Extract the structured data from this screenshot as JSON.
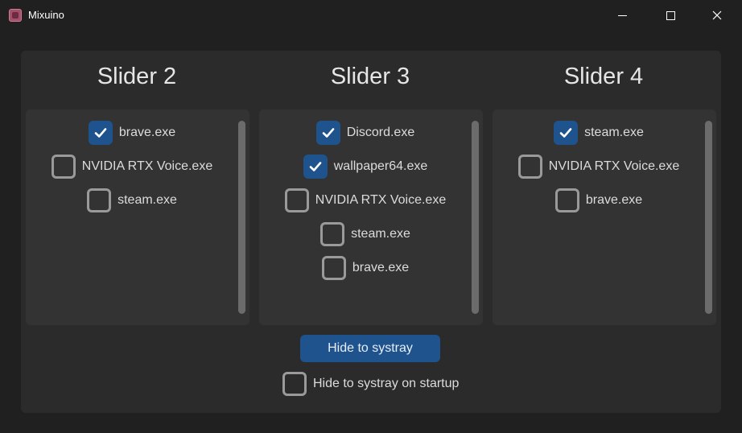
{
  "window": {
    "title": "Mixuino"
  },
  "columns": [
    {
      "title": "Slider 2",
      "items": [
        {
          "label": "brave.exe",
          "checked": true
        },
        {
          "label": "NVIDIA RTX Voice.exe",
          "checked": false
        },
        {
          "label": "steam.exe",
          "checked": false
        }
      ]
    },
    {
      "title": "Slider 3",
      "items": [
        {
          "label": "Discord.exe",
          "checked": true
        },
        {
          "label": "wallpaper64.exe",
          "checked": true
        },
        {
          "label": "NVIDIA RTX Voice.exe",
          "checked": false
        },
        {
          "label": "steam.exe",
          "checked": false
        },
        {
          "label": "brave.exe",
          "checked": false
        }
      ]
    },
    {
      "title": "Slider 4",
      "items": [
        {
          "label": "steam.exe",
          "checked": true
        },
        {
          "label": "NVIDIA RTX Voice.exe",
          "checked": false
        },
        {
          "label": "brave.exe",
          "checked": false
        }
      ]
    }
  ],
  "footer": {
    "hide_button_label": "Hide to systray",
    "startup_label": "Hide to systray on startup",
    "startup_checked": false
  },
  "colors": {
    "accent": "#1f538d",
    "background": "#202020",
    "frame": "#2b2b2b",
    "panel": "#333333"
  }
}
